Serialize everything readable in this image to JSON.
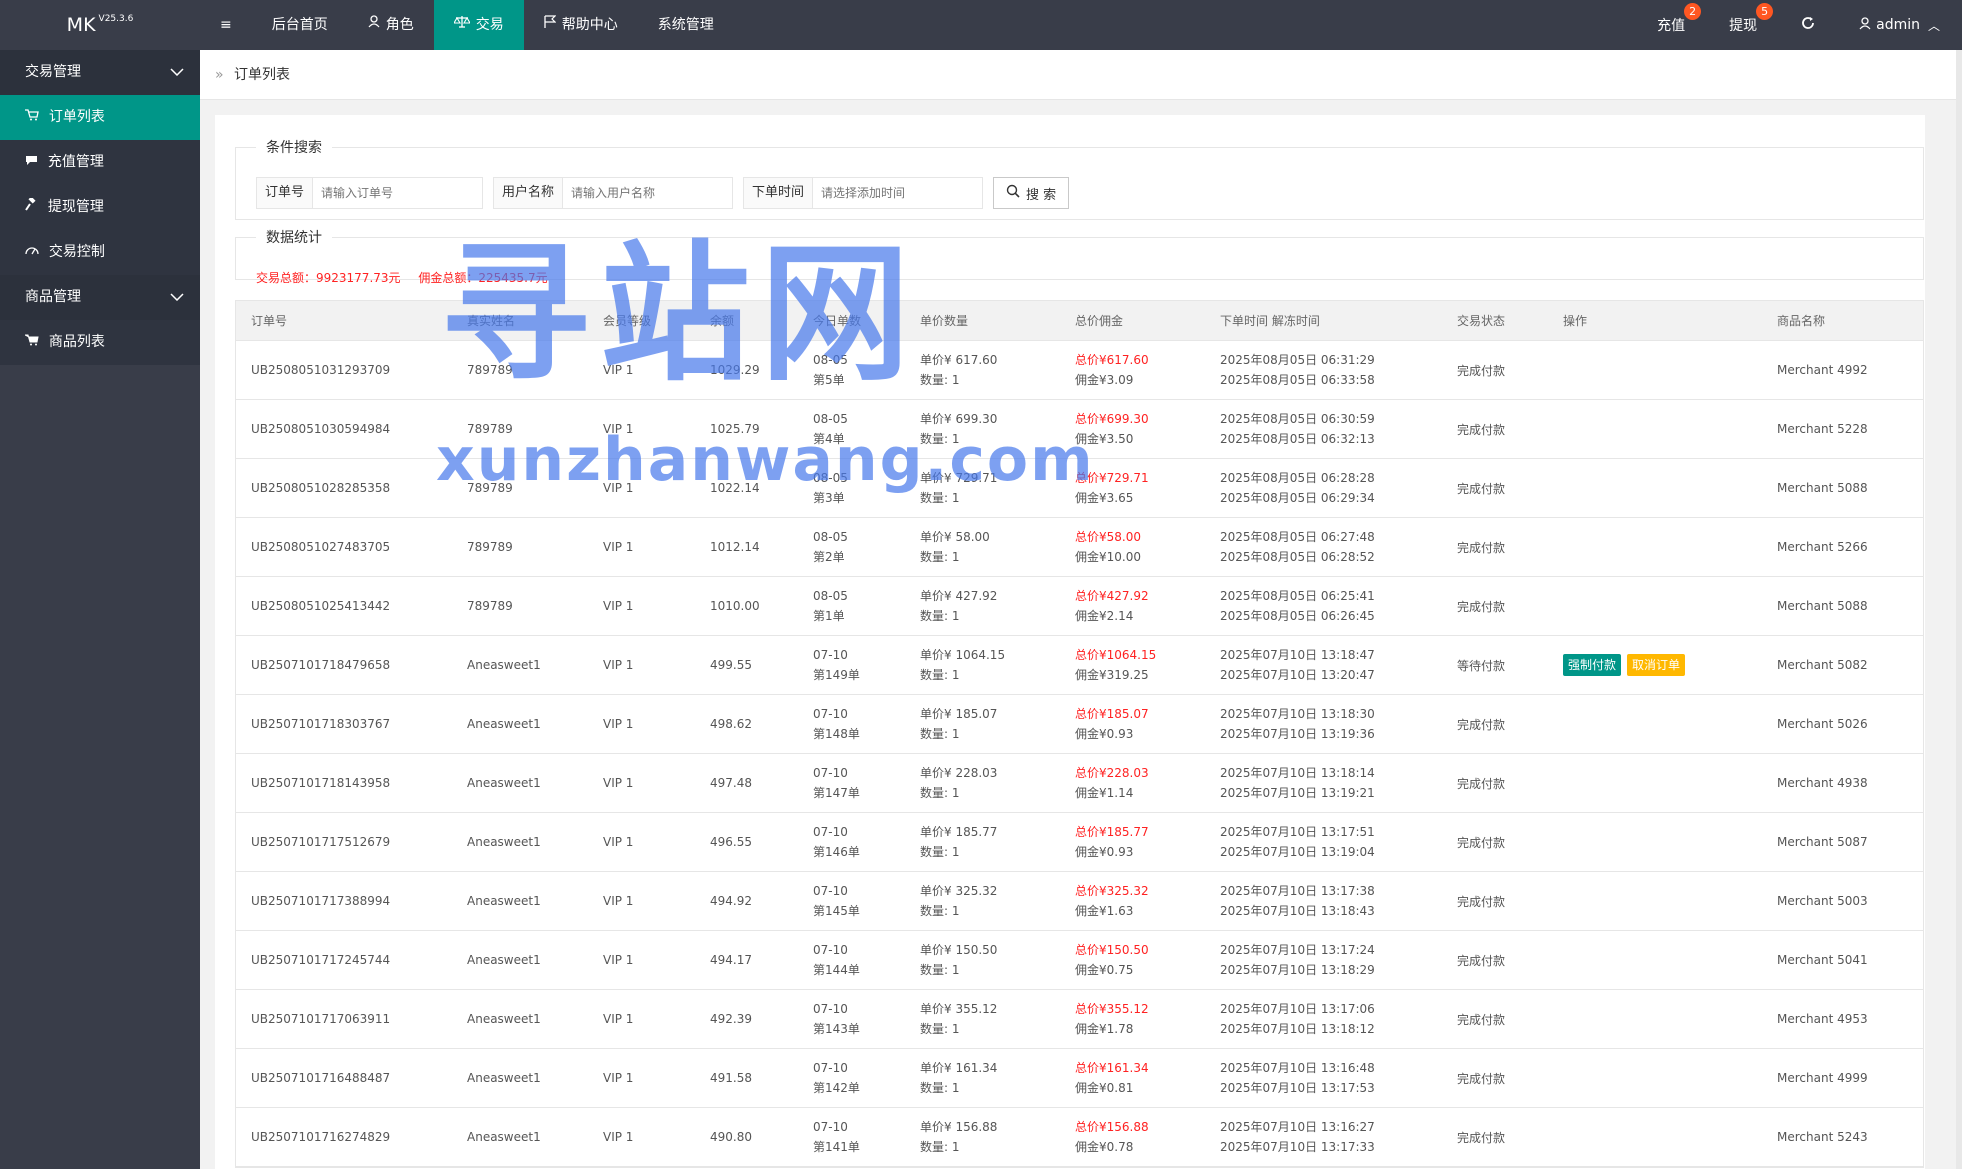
{
  "app": {
    "logo": "MK",
    "version": "V25.3.6"
  },
  "nav": {
    "menu_icon": "≡",
    "items": [
      {
        "label": "后台首页",
        "icon": ""
      },
      {
        "label": "角色",
        "icon": "user-icon"
      },
      {
        "label": "交易",
        "icon": "balance-icon"
      },
      {
        "label": "帮助中心",
        "icon": "flag-icon"
      },
      {
        "label": "系统管理",
        "icon": ""
      }
    ],
    "right": {
      "recharge": {
        "label": "充值",
        "badge": "2"
      },
      "withdraw": {
        "label": "提现",
        "badge": "5"
      },
      "user": "admin"
    }
  },
  "sidebar": {
    "groups": [
      {
        "label": "交易管理",
        "items": [
          {
            "label": "订单列表",
            "icon": "cart-icon"
          },
          {
            "label": "充值管理",
            "icon": "chat-icon"
          },
          {
            "label": "提现管理",
            "icon": "gavel-icon"
          },
          {
            "label": "交易控制",
            "icon": "dashboard-icon"
          }
        ]
      },
      {
        "label": "商品管理",
        "items": [
          {
            "label": "商品列表",
            "icon": "cart-icon"
          }
        ]
      }
    ]
  },
  "breadcrumb": {
    "sep": "»",
    "current": "订单列表"
  },
  "search": {
    "legend": "条件搜索",
    "order_label": "订单号",
    "order_placeholder": "请输入订单号",
    "user_label": "用户名称",
    "user_placeholder": "请输入用户名称",
    "time_label": "下单时间",
    "time_placeholder": "请选择添加时间",
    "button": "搜 索"
  },
  "stats": {
    "legend": "数据统计",
    "total_trade": "交易总额：9923177.73元",
    "total_commission": "佣金总额：225435.7元"
  },
  "table": {
    "headers": [
      "订单号",
      "真实姓名",
      "会员等级",
      "余额",
      "今日单数",
      "单价数量",
      "总价佣金",
      "下单时间 解冻时间",
      "交易状态",
      "操作",
      "商品名称"
    ],
    "rows": [
      {
        "order": "UB2508051031293709",
        "name": "789789",
        "level": "VIP 1",
        "balance": "1029.29",
        "date": "08-05",
        "num": "第5单",
        "price": "单价¥  617.60",
        "qty": "数量:  1",
        "total": "总价¥617.60",
        "comm": "佣金¥3.09",
        "t1": "2025年08月05日 06:31:29",
        "t2": "2025年08月05日 06:33:58",
        "status": "完成付款",
        "ops": [],
        "merchant": "Merchant 4992"
      },
      {
        "order": "UB2508051030594984",
        "name": "789789",
        "level": "VIP 1",
        "balance": "1025.79",
        "date": "08-05",
        "num": "第4单",
        "price": "单价¥  699.30",
        "qty": "数量:  1",
        "total": "总价¥699.30",
        "comm": "佣金¥3.50",
        "t1": "2025年08月05日 06:30:59",
        "t2": "2025年08月05日 06:32:13",
        "status": "完成付款",
        "ops": [],
        "merchant": "Merchant 5228"
      },
      {
        "order": "UB2508051028285358",
        "name": "789789",
        "level": "VIP 1",
        "balance": "1022.14",
        "date": "08-05",
        "num": "第3单",
        "price": "单价¥  729.71",
        "qty": "数量:  1",
        "total": "总价¥729.71",
        "comm": "佣金¥3.65",
        "t1": "2025年08月05日 06:28:28",
        "t2": "2025年08月05日 06:29:34",
        "status": "完成付款",
        "ops": [],
        "merchant": "Merchant 5088"
      },
      {
        "order": "UB2508051027483705",
        "name": "789789",
        "level": "VIP 1",
        "balance": "1012.14",
        "date": "08-05",
        "num": "第2单",
        "price": "单价¥  58.00",
        "qty": "数量:  1",
        "total": "总价¥58.00",
        "comm": "佣金¥10.00",
        "t1": "2025年08月05日 06:27:48",
        "t2": "2025年08月05日 06:28:52",
        "status": "完成付款",
        "ops": [],
        "merchant": "Merchant 5266"
      },
      {
        "order": "UB2508051025413442",
        "name": "789789",
        "level": "VIP 1",
        "balance": "1010.00",
        "date": "08-05",
        "num": "第1单",
        "price": "单价¥  427.92",
        "qty": "数量:  1",
        "total": "总价¥427.92",
        "comm": "佣金¥2.14",
        "t1": "2025年08月05日 06:25:41",
        "t2": "2025年08月05日 06:26:45",
        "status": "完成付款",
        "ops": [],
        "merchant": "Merchant 5088"
      },
      {
        "order": "UB2507101718479658",
        "name": "Aneasweet1",
        "level": "VIP 1",
        "balance": "499.55",
        "date": "07-10",
        "num": "第149单",
        "price": "单价¥  1064.15",
        "qty": "数量:  1",
        "total": "总价¥1064.15",
        "comm": "佣金¥319.25",
        "t1": "2025年07月10日 13:18:47",
        "t2": "2025年07月10日 13:20:47",
        "status": "等待付款",
        "ops": [
          {
            "label": "强制付款",
            "color": "#009688"
          },
          {
            "label": "取消订单",
            "color": "#ffb800"
          }
        ],
        "merchant": "Merchant 5082"
      },
      {
        "order": "UB2507101718303767",
        "name": "Aneasweet1",
        "level": "VIP 1",
        "balance": "498.62",
        "date": "07-10",
        "num": "第148单",
        "price": "单价¥  185.07",
        "qty": "数量:  1",
        "total": "总价¥185.07",
        "comm": "佣金¥0.93",
        "t1": "2025年07月10日 13:18:30",
        "t2": "2025年07月10日 13:19:36",
        "status": "完成付款",
        "ops": [],
        "merchant": "Merchant 5026"
      },
      {
        "order": "UB2507101718143958",
        "name": "Aneasweet1",
        "level": "VIP 1",
        "balance": "497.48",
        "date": "07-10",
        "num": "第147单",
        "price": "单价¥  228.03",
        "qty": "数量:  1",
        "total": "总价¥228.03",
        "comm": "佣金¥1.14",
        "t1": "2025年07月10日 13:18:14",
        "t2": "2025年07月10日 13:19:21",
        "status": "完成付款",
        "ops": [],
        "merchant": "Merchant 4938"
      },
      {
        "order": "UB2507101717512679",
        "name": "Aneasweet1",
        "level": "VIP 1",
        "balance": "496.55",
        "date": "07-10",
        "num": "第146单",
        "price": "单价¥  185.77",
        "qty": "数量:  1",
        "total": "总价¥185.77",
        "comm": "佣金¥0.93",
        "t1": "2025年07月10日 13:17:51",
        "t2": "2025年07月10日 13:19:04",
        "status": "完成付款",
        "ops": [],
        "merchant": "Merchant 5087"
      },
      {
        "order": "UB2507101717388994",
        "name": "Aneasweet1",
        "level": "VIP 1",
        "balance": "494.92",
        "date": "07-10",
        "num": "第145单",
        "price": "单价¥  325.32",
        "qty": "数量:  1",
        "total": "总价¥325.32",
        "comm": "佣金¥1.63",
        "t1": "2025年07月10日 13:17:38",
        "t2": "2025年07月10日 13:18:43",
        "status": "完成付款",
        "ops": [],
        "merchant": "Merchant 5003"
      },
      {
        "order": "UB2507101717245744",
        "name": "Aneasweet1",
        "level": "VIP 1",
        "balance": "494.17",
        "date": "07-10",
        "num": "第144单",
        "price": "单价¥  150.50",
        "qty": "数量:  1",
        "total": "总价¥150.50",
        "comm": "佣金¥0.75",
        "t1": "2025年07月10日 13:17:24",
        "t2": "2025年07月10日 13:18:29",
        "status": "完成付款",
        "ops": [],
        "merchant": "Merchant 5041"
      },
      {
        "order": "UB2507101717063911",
        "name": "Aneasweet1",
        "level": "VIP 1",
        "balance": "492.39",
        "date": "07-10",
        "num": "第143单",
        "price": "单价¥  355.12",
        "qty": "数量:  1",
        "total": "总价¥355.12",
        "comm": "佣金¥1.78",
        "t1": "2025年07月10日 13:17:06",
        "t2": "2025年07月10日 13:18:12",
        "status": "完成付款",
        "ops": [],
        "merchant": "Merchant 4953"
      },
      {
        "order": "UB2507101716488487",
        "name": "Aneasweet1",
        "level": "VIP 1",
        "balance": "491.58",
        "date": "07-10",
        "num": "第142单",
        "price": "单价¥  161.34",
        "qty": "数量:  1",
        "total": "总价¥161.34",
        "comm": "佣金¥0.81",
        "t1": "2025年07月10日 13:16:48",
        "t2": "2025年07月10日 13:17:53",
        "status": "完成付款",
        "ops": [],
        "merchant": "Merchant 4999"
      },
      {
        "order": "UB2507101716274829",
        "name": "Aneasweet1",
        "level": "VIP 1",
        "balance": "490.80",
        "date": "07-10",
        "num": "第141单",
        "price": "单价¥  156.88",
        "qty": "数量:  1",
        "total": "总价¥156.88",
        "comm": "佣金¥0.78",
        "t1": "2025年07月10日 13:16:27",
        "t2": "2025年07月10日 13:17:33",
        "status": "完成付款",
        "ops": [],
        "merchant": "Merchant 5243"
      }
    ]
  },
  "watermark": {
    "big": "寻站网",
    "small": "xunzhanwang.com"
  }
}
